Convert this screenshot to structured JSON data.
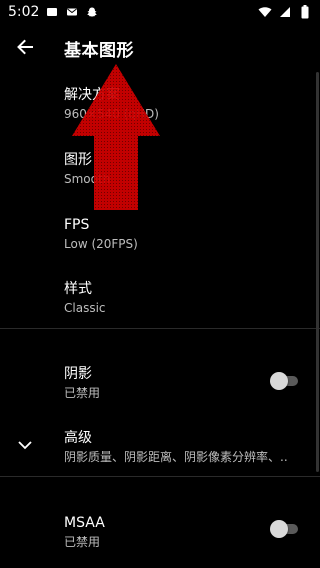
{
  "status_bar": {
    "time": "5:02",
    "icons": [
      "notification-icon",
      "mail-icon",
      "snapchat-icon",
      "wifi-icon",
      "signal-icon",
      "battery-icon"
    ]
  },
  "toolbar": {
    "title": "基本图形",
    "back_icon": "arrow-back-icon"
  },
  "preferences": {
    "resolution": {
      "title": "解决方案",
      "summary": "960×540 (qHD)"
    },
    "graphics": {
      "title": "图形",
      "summary": "Smooth"
    },
    "fps": {
      "title": "FPS",
      "summary": "Low (20FPS)"
    },
    "style": {
      "title": "样式",
      "summary": "Classic"
    },
    "shadow": {
      "title": "阴影",
      "summary": "已禁用",
      "enabled": false
    },
    "advanced": {
      "title": "高级",
      "summary": "阴影质量、阴影距离、阴影像素分辨率、.."
    },
    "msaa": {
      "title": "MSAA",
      "summary": "已禁用",
      "enabled": false
    }
  },
  "colors": {
    "background": "#000000",
    "arrow": "#d10000",
    "toggle_off_track": "#5a5a5a",
    "toggle_off_thumb": "#d9d9d9"
  }
}
